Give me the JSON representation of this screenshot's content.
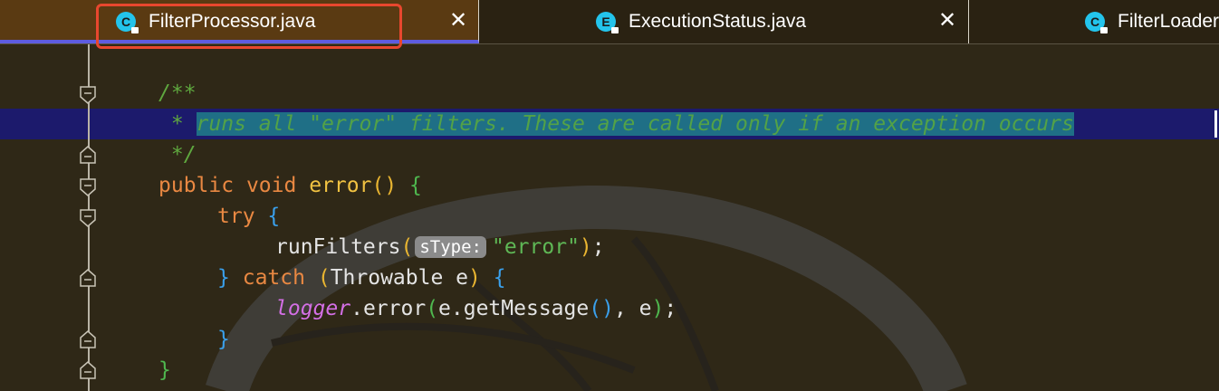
{
  "tabs": [
    {
      "icon": "C",
      "label": "FilterProcessor.java",
      "close": "✕",
      "active": true
    },
    {
      "icon": "E",
      "label": "ExecutionStatus.java",
      "close": "✕",
      "active": false
    },
    {
      "icon": "C",
      "label": "FilterLoader.java",
      "active": false
    }
  ],
  "code": {
    "javadoc_open": "/**",
    "javadoc_star": " * ",
    "javadoc_text": "runs all \"error\" filters. These are called only if an exception occurs",
    "javadoc_close": " */",
    "kw_public": "public",
    "kw_void": "void",
    "method_error": "error",
    "open_paren": "(",
    "close_paren": ")",
    "open_brace": "{",
    "close_brace": "}",
    "kw_try": "try",
    "call_runFilters": "runFilters",
    "param_hint": "sType:",
    "str_error": "\"error\"",
    "semicolon": ";",
    "kw_catch": "catch",
    "type_throwable": "Throwable e",
    "field_logger": "logger",
    "call_error": ".error",
    "arg_e_getMessage": "e.getMessage",
    "comma_e": ", e"
  },
  "colors": {
    "tab_icon": "#23c4ec",
    "active_tab_bg": "#5a3a12",
    "active_tab_underline": "#5e5ce0",
    "focus_outline": "#e8472e",
    "editor_bg": "#2f2817",
    "selection_bg": "#1f6f86",
    "current_line_bg": "#1c1a6c"
  }
}
